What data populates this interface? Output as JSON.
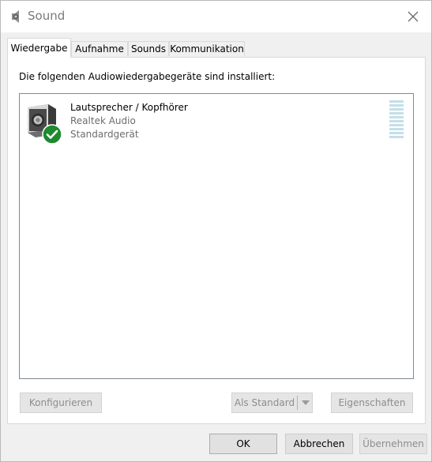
{
  "window": {
    "title": "Sound"
  },
  "tabs": [
    {
      "label": "Wiedergabe",
      "active": true
    },
    {
      "label": "Aufnahme",
      "active": false
    },
    {
      "label": "Sounds",
      "active": false
    },
    {
      "label": "Kommunikation",
      "active": false
    }
  ],
  "playback": {
    "instruction": "Die folgenden Audiowiedergabegeräte sind installiert:",
    "devices": [
      {
        "name": "Lautsprecher / Kopfhörer",
        "driver": "Realtek Audio",
        "status": "Standardgerät",
        "icon": "speaker-icon",
        "badge": "default-check-icon",
        "level": 0
      }
    ],
    "buttons": {
      "configure": "Konfigurieren",
      "set_default": "Als Standard",
      "properties": "Eigenschaften"
    }
  },
  "dialog_buttons": {
    "ok": "OK",
    "cancel": "Abbrechen",
    "apply": "Übernehmen"
  },
  "colors": {
    "check_badge": "#1e8a2e",
    "meter": "#c5dfe9",
    "dialog_bg": "#f0f0f0"
  }
}
